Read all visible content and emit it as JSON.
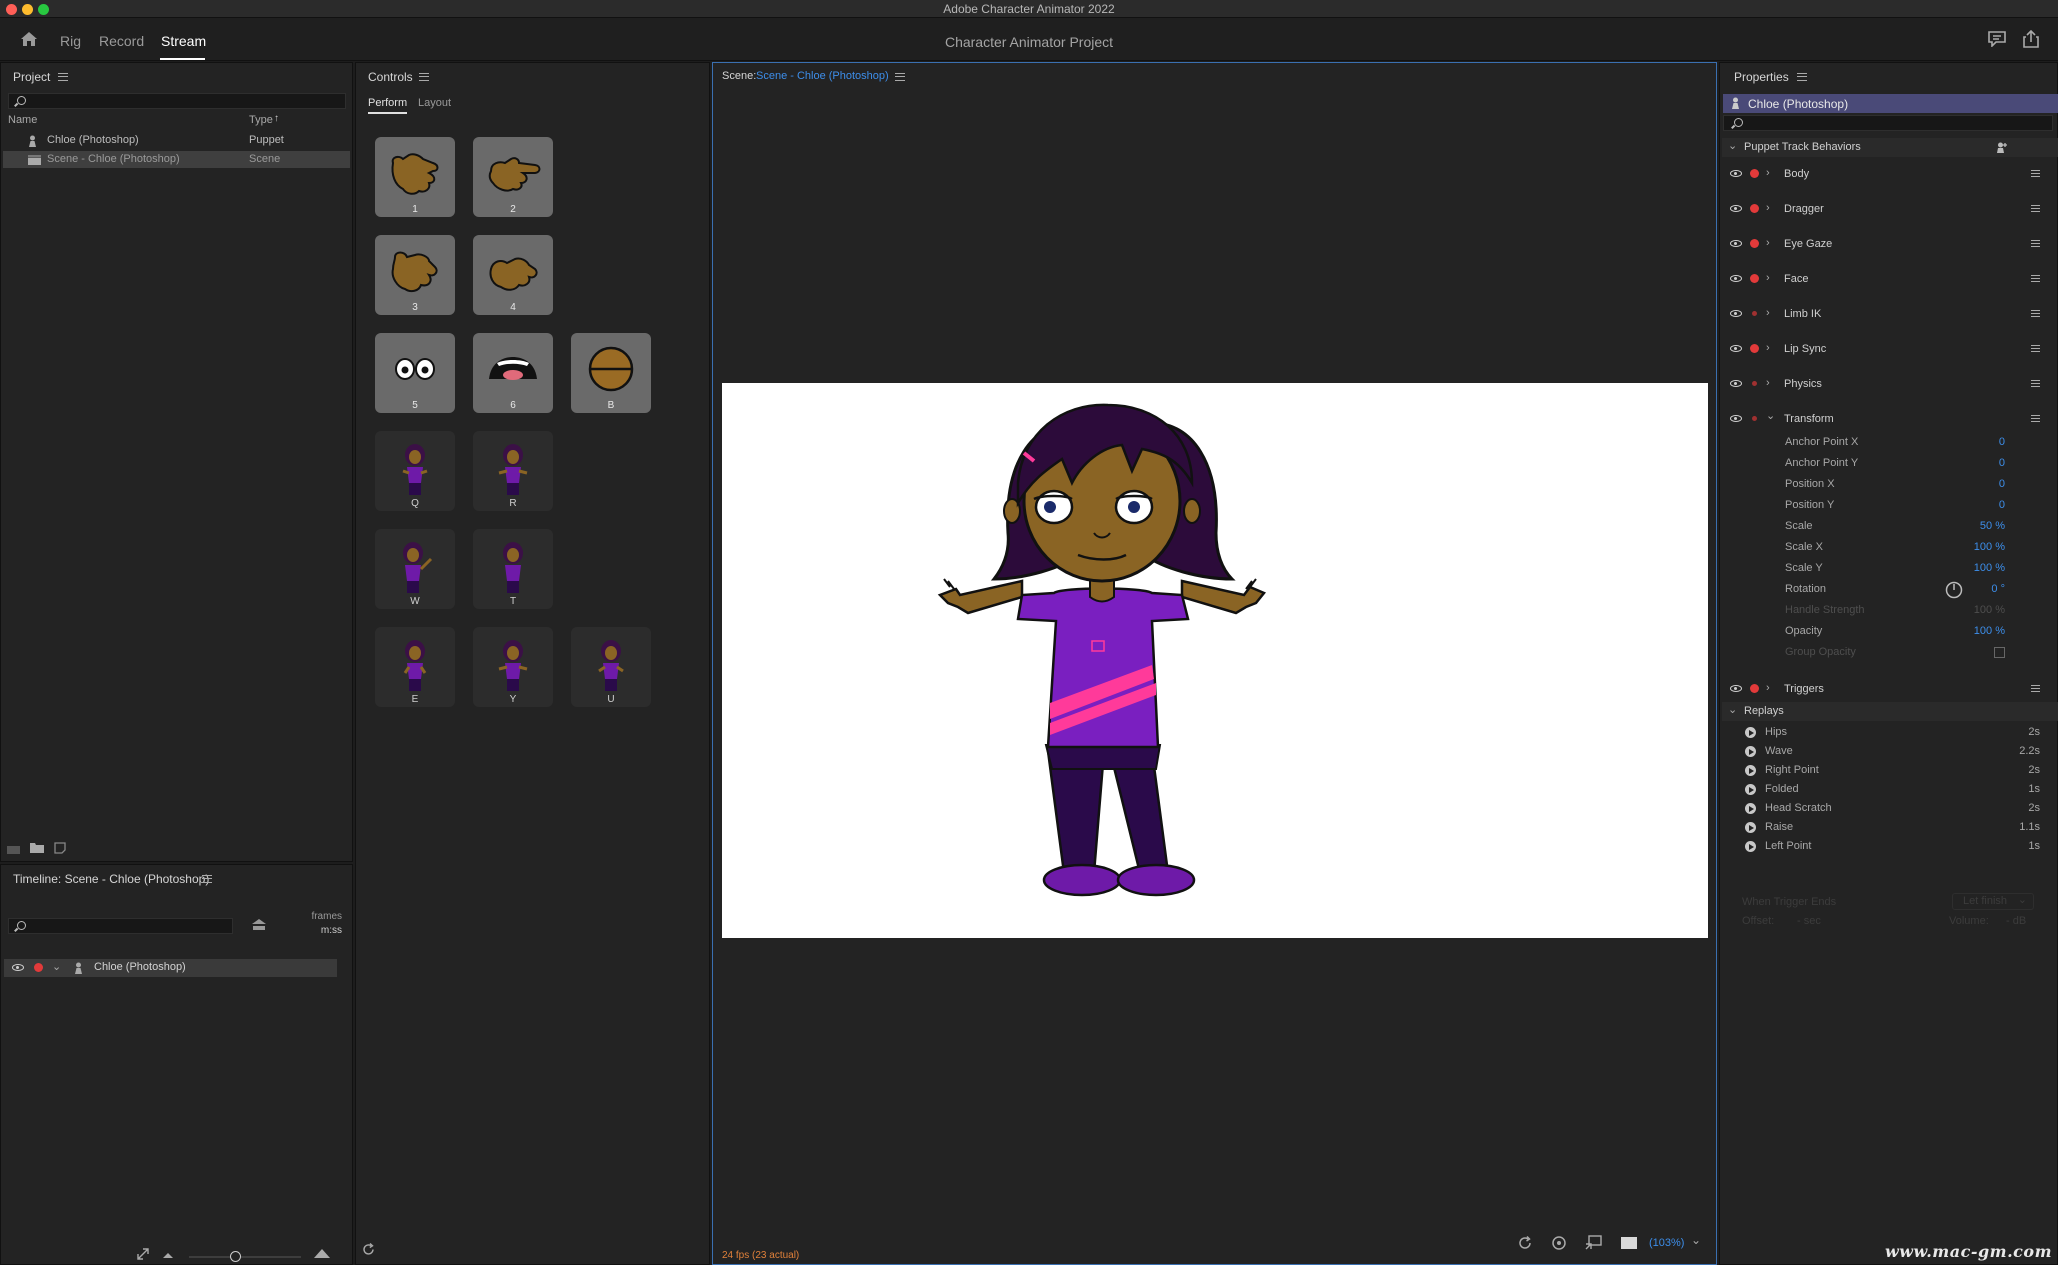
{
  "app": {
    "window_title": "Adobe Character Animator 2022",
    "project_name": "Character Animator Project",
    "workspaces": [
      "Rig",
      "Record",
      "Stream"
    ],
    "active_workspace": "Stream"
  },
  "project_panel": {
    "title": "Project",
    "search_placeholder": "",
    "col_name": "Name",
    "col_type": "Type",
    "sort_icon": "arrow-up-icon",
    "items": [
      {
        "name": "Chloe (Photoshop)",
        "type": "Puppet",
        "icon": "puppet-icon",
        "selected": false
      },
      {
        "name": "Scene - Chloe (Photoshop)",
        "type": "Scene",
        "icon": "scene-icon",
        "selected": true
      }
    ]
  },
  "controls_panel": {
    "title": "Controls",
    "tabs": [
      "Perform",
      "Layout"
    ],
    "active_tab": "Perform",
    "hand_tiles": [
      {
        "key": "1",
        "name": "hand-1"
      },
      {
        "key": "2",
        "name": "hand-2"
      },
      {
        "key": "3",
        "name": "hand-3"
      },
      {
        "key": "4",
        "name": "hand-4"
      },
      {
        "key": "5",
        "name": "eyes"
      },
      {
        "key": "6",
        "name": "mouth"
      },
      {
        "key": "B",
        "name": "blink"
      }
    ],
    "pose_tiles": [
      {
        "key": "Q"
      },
      {
        "key": "R"
      },
      {
        "key": "W"
      },
      {
        "key": "T"
      },
      {
        "key": "E"
      },
      {
        "key": "Y"
      },
      {
        "key": "U"
      }
    ]
  },
  "scene_panel": {
    "label": "Scene:",
    "scene_name": "Scene - Chloe (Photoshop)",
    "fps": "24 fps (23 actual)",
    "zoom": "(103%)"
  },
  "timeline_panel": {
    "title": "Timeline: Scene - Chloe (Photoshop)",
    "units_top": "frames",
    "units_bottom": "m:ss",
    "track": "Chloe (Photoshop)"
  },
  "properties_panel": {
    "title": "Properties",
    "puppet": "Chloe (Photoshop)",
    "section": "Puppet Track Behaviors",
    "behaviors": [
      {
        "name": "Body",
        "armed": true
      },
      {
        "name": "Dragger",
        "armed": true
      },
      {
        "name": "Eye Gaze",
        "armed": true
      },
      {
        "name": "Face",
        "armed": true
      },
      {
        "name": "Limb IK",
        "armed": false
      },
      {
        "name": "Lip Sync",
        "armed": true
      },
      {
        "name": "Physics",
        "armed": false
      },
      {
        "name": "Transform",
        "armed": false
      }
    ],
    "transform_params": [
      {
        "label": "Anchor Point X",
        "value": "0",
        "dim": false
      },
      {
        "label": "Anchor Point Y",
        "value": "0",
        "dim": false
      },
      {
        "label": "Position X",
        "value": "0",
        "dim": false
      },
      {
        "label": "Position Y",
        "value": "0",
        "dim": false
      },
      {
        "label": "Scale",
        "value": "50 %",
        "dim": false
      },
      {
        "label": "Scale X",
        "value": "100 %",
        "dim": false
      },
      {
        "label": "Scale Y",
        "value": "100 %",
        "dim": false
      },
      {
        "label": "Rotation",
        "value": "0 °",
        "dim": false
      },
      {
        "label": "Handle Strength",
        "value": "100 %",
        "dim": true
      },
      {
        "label": "Opacity",
        "value": "100 %",
        "dim": false
      },
      {
        "label": "Group Opacity",
        "value": "",
        "dim": true
      }
    ],
    "triggers_label": "Triggers",
    "replays_label": "Replays",
    "replays": [
      {
        "name": "Hips",
        "duration": "2s"
      },
      {
        "name": "Wave",
        "duration": "2.2s"
      },
      {
        "name": "Right Point",
        "duration": "2s"
      },
      {
        "name": "Folded",
        "duration": "1s"
      },
      {
        "name": "Head Scratch",
        "duration": "2s"
      },
      {
        "name": "Raise",
        "duration": "1.1s"
      },
      {
        "name": "Left Point",
        "duration": "1s"
      }
    ],
    "when_trigger_ends": "When Trigger Ends",
    "when_trigger_ends_value": "Let finish",
    "offset_label": "Offset:",
    "offset_value": "- sec",
    "volume_label": "Volume:",
    "volume_value": "- dB"
  },
  "watermark": "www.mac-gm.com",
  "colors": {
    "accent_blue": "#3d8eea",
    "record_red": "#e23a3a",
    "fps_orange": "#e0803a",
    "puppet_header": "#4a4a78"
  }
}
